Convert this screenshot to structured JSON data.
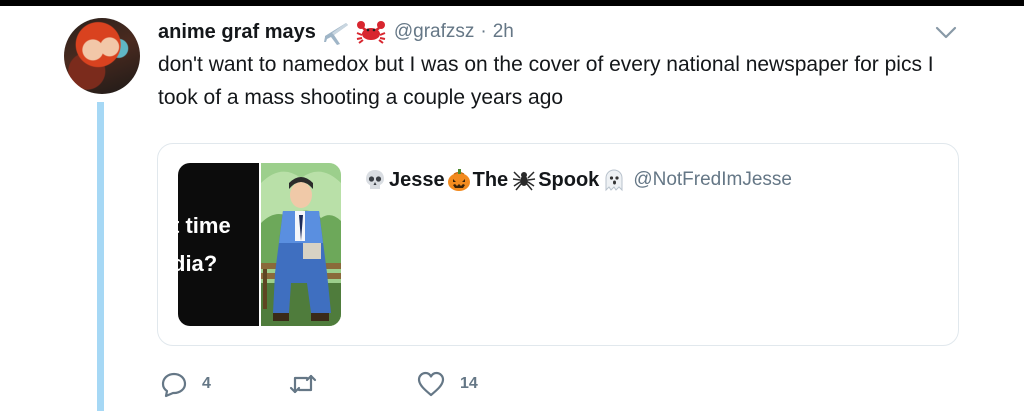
{
  "tweet": {
    "author_name": "anime graf mays",
    "author_emojis": [
      "airplane-icon",
      "crab-icon"
    ],
    "handle": "@grafzsz",
    "separator": "·",
    "time": "2h",
    "text": "don't want to namedox but I was on the cover of every national newspaper for pics I took of a mass shooting a couple years ago"
  },
  "quote": {
    "name_parts": [
      "Jesse",
      "The",
      "Spook"
    ],
    "handle": "@NotFredImJesse",
    "media_text": [
      "t time",
      "dia?"
    ]
  },
  "actions": {
    "replies": "4",
    "retweets": "",
    "likes": "14"
  },
  "colors": {
    "thread_line": "#a6d8f5",
    "secondary_text": "#657786",
    "border": "#e1e8ed"
  }
}
